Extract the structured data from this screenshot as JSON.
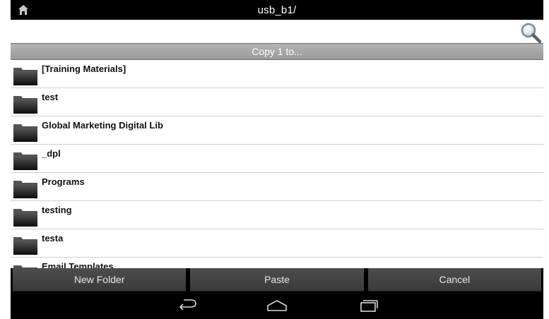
{
  "titlebar": {
    "path": "usb_b1/"
  },
  "copy_header": "Copy 1 to...",
  "folders": [
    {
      "name": "[Training Materials]"
    },
    {
      "name": "test"
    },
    {
      "name": "Global Marketing Digital Lib"
    },
    {
      "name": "_dpl"
    },
    {
      "name": "Programs"
    },
    {
      "name": "testing"
    },
    {
      "name": "testa"
    },
    {
      "name": "Email Templates"
    }
  ],
  "actions": {
    "new_folder": "New Folder",
    "paste": "Paste",
    "cancel": "Cancel"
  },
  "icons": {
    "home": "home-icon",
    "search": "search-icon",
    "folder": "folder-icon",
    "back": "back-icon",
    "home_nav": "home-nav-icon",
    "recents": "recents-icon"
  },
  "colors": {
    "titlebar_bg": "#000000",
    "copybar_bg": "#a8a8a8",
    "button_bg": "#444444",
    "divider": "#cfcfcf"
  }
}
